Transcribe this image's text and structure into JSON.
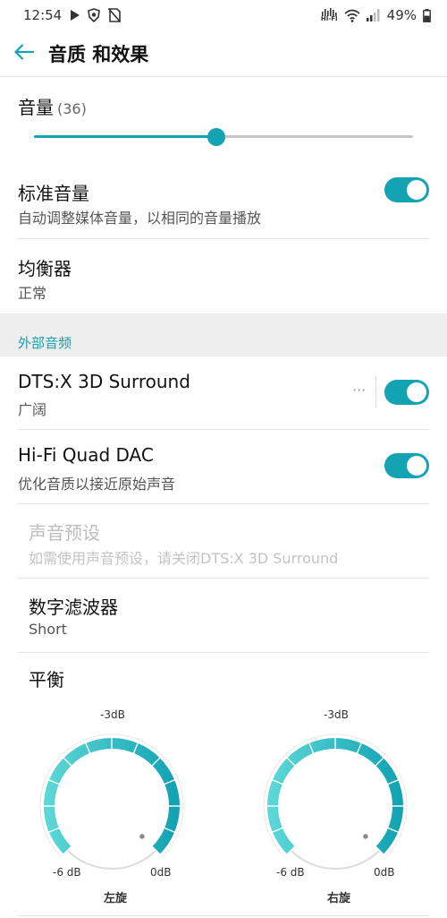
{
  "status_bar": {
    "time": "12:54",
    "hifi_label": "HI-FI",
    "battery": "49%"
  },
  "header": {
    "title": "音质 和效果"
  },
  "volume": {
    "label": "音量",
    "value_text": "(36)",
    "fraction": 0.48
  },
  "rows": {
    "standard_volume": {
      "title": "标准音量",
      "subtitle": "自动调整媒体音量，以相同的音量播放",
      "on": true
    },
    "equalizer": {
      "title": "均衡器",
      "subtitle": "正常"
    }
  },
  "section_external": {
    "title": "外部音频"
  },
  "external": {
    "dts": {
      "title": "DTS:X 3D Surround",
      "subtitle": "广阔",
      "more": "···",
      "on": true
    },
    "hifi": {
      "title": "Hi-Fi Quad DAC",
      "subtitle": "优化音质以接近原始声音",
      "on": true
    },
    "preset": {
      "title": "声音预设",
      "subtitle": "如需使用声音预设，请关闭DTS:X 3D Surround",
      "disabled": true
    },
    "filter": {
      "title": "数字滤波器",
      "subtitle": "Short"
    },
    "balance": {
      "title": "平衡"
    }
  },
  "balance_knobs": [
    {
      "name": "左旋",
      "top_label": "-3dB",
      "left_label": "-6 dB",
      "right_label": "0dB"
    },
    {
      "name": "右旋",
      "top_label": "-3dB",
      "left_label": "-6 dB",
      "right_label": "0dB"
    }
  ],
  "colors": {
    "accent": "#13a3b3",
    "accent_light": "#5cd6d6",
    "section_bg": "#eeeeee"
  }
}
